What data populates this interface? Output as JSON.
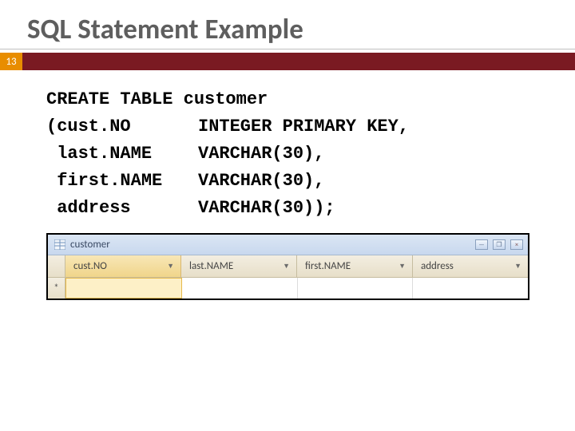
{
  "title": "SQL Statement Example",
  "slide_number": "13",
  "code": {
    "l1": "CREATE TABLE customer",
    "l2a": "(cust.NO",
    "l2b": "INTEGER PRIMARY KEY,",
    "l3a": " last.NAME",
    "l3b": "VARCHAR(30),",
    "l4a": " first.NAME",
    "l4b": "VARCHAR(30),",
    "l5a": " address",
    "l5b": "VARCHAR(30));"
  },
  "table": {
    "name": "customer",
    "columns": [
      "cust.NO",
      "last.NAME",
      "first.NAME",
      "address"
    ],
    "new_row_marker": "*"
  },
  "win": {
    "minimize": "—",
    "restore": "❐",
    "close": "×"
  }
}
